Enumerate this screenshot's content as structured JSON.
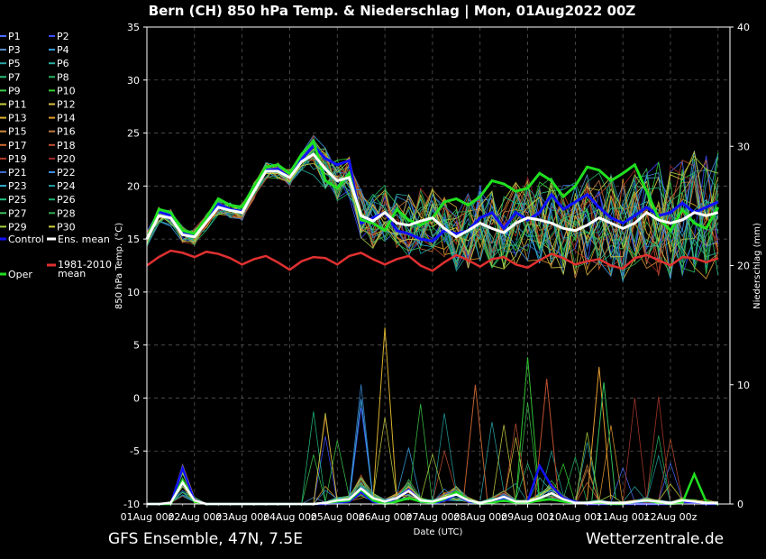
{
  "footer": {
    "left": "GFS Ensemble, 47N, 7.5E",
    "right": "Wetterzentrale.de"
  },
  "chart_data": {
    "type": "line",
    "title": "Bern  (CH)  850 hPa Temp. & Niederschlag | Mon, 01Aug2022 00Z",
    "xlabel": "Date (UTC)",
    "ylabel": "850 hPa Temp. (°C)",
    "y2label": "Niederschlag (mm)",
    "ylim": [
      -10,
      35
    ],
    "y2lim": [
      0,
      40
    ],
    "yticks": [
      -10,
      -5,
      0,
      5,
      10,
      15,
      20,
      25,
      30,
      35
    ],
    "y2ticks": [
      0,
      10,
      20,
      30,
      40
    ],
    "x_tick_labels": [
      "01Aug 00z",
      "02Aug 00z",
      "03Aug 00z",
      "04Aug 00z",
      "05Aug 00z",
      "06Aug 00z",
      "07Aug 00z",
      "08Aug 00z",
      "09Aug 00z",
      "10Aug 00z",
      "11Aug 00z",
      "12Aug 00z"
    ],
    "x_hours_step": 6,
    "x_days_span": 12.25,
    "grid": true,
    "legend_placement": "left",
    "legend": [
      {
        "name": "P1",
        "color": "#4a6cff"
      },
      {
        "name": "P2",
        "color": "#3b4bff"
      },
      {
        "name": "P3",
        "color": "#5a8fd0"
      },
      {
        "name": "P4",
        "color": "#3aa0e0"
      },
      {
        "name": "P5",
        "color": "#2aa6a6"
      },
      {
        "name": "P6",
        "color": "#26b0a0"
      },
      {
        "name": "P7",
        "color": "#2bbf7a"
      },
      {
        "name": "P8",
        "color": "#25b560"
      },
      {
        "name": "P9",
        "color": "#3cc84a"
      },
      {
        "name": "P10",
        "color": "#30d030"
      },
      {
        "name": "P11",
        "color": "#c8d040"
      },
      {
        "name": "P12",
        "color": "#d8c040"
      },
      {
        "name": "P13",
        "color": "#e0b030"
      },
      {
        "name": "P14",
        "color": "#e09a30"
      },
      {
        "name": "P15",
        "color": "#d08a40"
      },
      {
        "name": "P16",
        "color": "#c07a40"
      },
      {
        "name": "P17",
        "color": "#d06a30"
      },
      {
        "name": "P18",
        "color": "#c05030"
      },
      {
        "name": "P19",
        "color": "#b03a2a"
      },
      {
        "name": "P20",
        "color": "#a02a2a"
      },
      {
        "name": "P21",
        "color": "#3a6ad0"
      },
      {
        "name": "P22",
        "color": "#3a90e0"
      },
      {
        "name": "P23",
        "color": "#30b0d0"
      },
      {
        "name": "P24",
        "color": "#20a0a0"
      },
      {
        "name": "P25",
        "color": "#20c080"
      },
      {
        "name": "P26",
        "color": "#20b070"
      },
      {
        "name": "P27",
        "color": "#40c060"
      },
      {
        "name": "P28",
        "color": "#30a850"
      },
      {
        "name": "P29",
        "color": "#a8d040"
      },
      {
        "name": "P30",
        "color": "#d0d040"
      },
      {
        "name": "Control",
        "color": "#1010ff"
      },
      {
        "name": "Ens. mean",
        "color": "#ffffff"
      },
      {
        "name": "Oper",
        "color": "#20e020"
      },
      {
        "name": "1981-2010 mean",
        "color": "#e03030"
      }
    ],
    "series_main": {
      "control": [
        15.0,
        17.6,
        17.2,
        15.6,
        15.3,
        16.7,
        18.3,
        17.8,
        17.6,
        19.6,
        21.5,
        21.6,
        20.8,
        22.5,
        23.8,
        22.6,
        22.0,
        22.4,
        16.5,
        17.0,
        17.5,
        15.8,
        15.5,
        15.0,
        14.8,
        15.8,
        15.5,
        15.8,
        17.0,
        17.5,
        16.0,
        17.5,
        16.8,
        17.5,
        19.2,
        17.8,
        18.5,
        19.2,
        18.0,
        17.0,
        16.5,
        17.2,
        18.0,
        17.2,
        17.5,
        18.4,
        17.5,
        18.0,
        18.5
      ],
      "ens_mean": [
        15.0,
        17.2,
        17.0,
        15.4,
        15.2,
        16.6,
        18.0,
        17.7,
        17.5,
        19.5,
        21.4,
        21.4,
        20.8,
        22.3,
        23.0,
        21.6,
        20.5,
        20.8,
        17.2,
        16.7,
        17.5,
        16.5,
        16.3,
        16.7,
        17.0,
        16.0,
        15.2,
        15.8,
        16.5,
        16.0,
        15.6,
        16.5,
        17.0,
        16.8,
        16.5,
        16.0,
        15.8,
        16.3,
        17.0,
        16.5,
        16.0,
        16.5,
        17.5,
        16.8,
        16.5,
        16.8,
        17.5,
        17.2,
        17.5
      ],
      "oper": [
        15.0,
        17.8,
        17.5,
        15.8,
        15.5,
        17.0,
        18.8,
        18.2,
        18.0,
        20.0,
        21.8,
        22.0,
        21.2,
        23.0,
        24.2,
        20.5,
        19.8,
        21.2,
        16.8,
        16.5,
        15.8,
        17.8,
        16.8,
        16.3,
        17.0,
        18.5,
        18.8,
        18.2,
        19.0,
        20.5,
        20.2,
        19.5,
        19.8,
        21.2,
        20.5,
        19.0,
        20.0,
        21.8,
        21.5,
        20.5,
        21.2,
        22.0,
        19.5,
        17.0,
        15.8,
        17.8,
        16.5,
        16.0,
        18.0
      ],
      "climo": [
        12.5,
        13.3,
        13.9,
        13.7,
        13.3,
        13.8,
        13.6,
        13.2,
        12.6,
        13.1,
        13.4,
        12.8,
        12.1,
        12.9,
        13.3,
        13.2,
        12.6,
        13.4,
        13.7,
        13.1,
        12.6,
        13.1,
        13.4,
        12.5,
        12.0,
        12.8,
        13.5,
        13.0,
        12.4,
        13.1,
        13.3,
        12.6,
        12.3,
        13.0,
        13.6,
        13.2,
        12.6,
        12.9,
        13.1,
        12.5,
        12.2,
        13.2,
        13.5,
        13.0,
        12.5,
        13.3,
        13.2,
        12.8,
        13.2
      ]
    },
    "precip_main": {
      "control": [
        0,
        0,
        0,
        3,
        0.3,
        0,
        0,
        0,
        0,
        0,
        0,
        0,
        0,
        0,
        0,
        0,
        0.1,
        0.2,
        1,
        0.2,
        0,
        0.5,
        1.2,
        0.3,
        0,
        0.3,
        0.8,
        0.2,
        0,
        0.1,
        0.4,
        0.1,
        0.2,
        3.2,
        1.5,
        0.5,
        0.2,
        0,
        0,
        0,
        0,
        0,
        0,
        0,
        0,
        0.2,
        0.1,
        0,
        0
      ],
      "ens_mean": [
        0,
        0,
        0.1,
        1.8,
        0.3,
        0,
        0,
        0,
        0,
        0,
        0,
        0,
        0,
        0,
        0,
        0.1,
        0.3,
        0.4,
        1.3,
        0.5,
        0.2,
        0.5,
        1.1,
        0.3,
        0.2,
        0.5,
        0.8,
        0.3,
        0.1,
        0.3,
        0.6,
        0.2,
        0.2,
        0.5,
        0.9,
        0.4,
        0.1,
        0.1,
        0.2,
        0.1,
        0.1,
        0.2,
        0.3,
        0.2,
        0.1,
        0.3,
        0.2,
        0.1,
        0.1
      ],
      "oper": [
        0,
        0,
        0,
        2.0,
        0.2,
        0,
        0,
        0,
        0,
        0,
        0,
        0,
        0,
        0,
        0,
        0.1,
        0.2,
        0.3,
        1.2,
        0.3,
        0,
        0.2,
        0.5,
        0.2,
        0.1,
        0.4,
        1.0,
        0.3,
        0,
        0.1,
        0.3,
        0.1,
        0.1,
        0.3,
        0.4,
        0.2,
        0.1,
        0.1,
        0.1,
        0,
        0,
        0.2,
        0.3,
        0.1,
        0,
        0.1,
        2.5,
        0.2,
        0
      ]
    },
    "annotations": {
      "precip_peak_mm": 14.8,
      "precip_peak_day": 5.0
    }
  }
}
